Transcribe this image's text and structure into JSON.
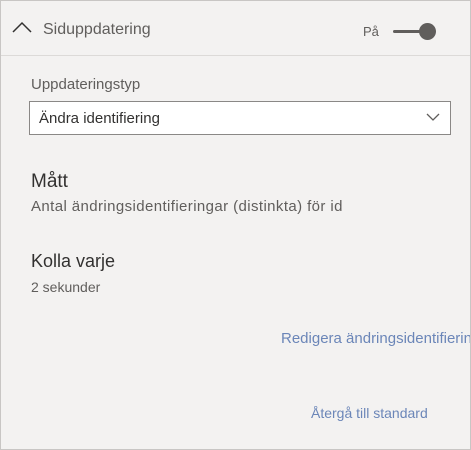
{
  "header": {
    "title": "Siduppdatering",
    "toggle_state": "På"
  },
  "refresh_type": {
    "label": "Uppdateringstyp",
    "selected": "Ändra identifiering"
  },
  "measure": {
    "heading": "Mått",
    "value": "Antal ändringsidentifieringar (distinkta) för id"
  },
  "check_every": {
    "heading": "Kolla varje",
    "value": "2 sekunder"
  },
  "links": {
    "edit_change_detection": "Redigera ändringsidentifiering",
    "reset_default": "Återgå till standard"
  },
  "colors": {
    "background": "#f3f2f1",
    "link": "#6b86b8",
    "toggle": "#605e5c"
  },
  "icons": {
    "collapse": "chevron-up-icon",
    "dropdown": "chevron-down-icon"
  }
}
